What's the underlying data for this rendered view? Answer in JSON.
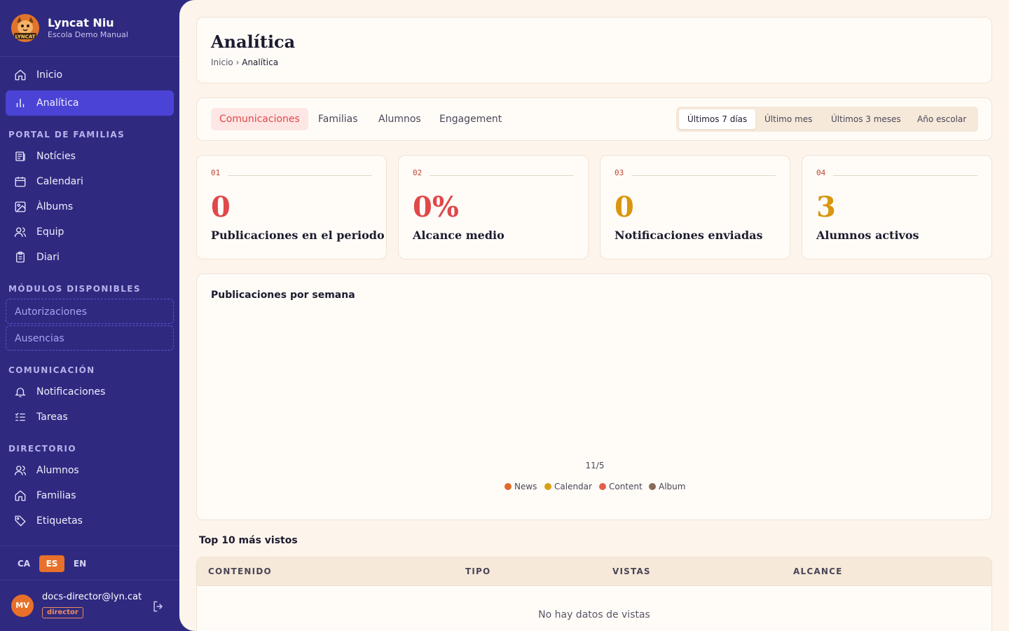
{
  "app": {
    "name": "Lyncat Niu",
    "school": "Escola Demo Manual",
    "logo_text": "LYNCAT"
  },
  "nav": {
    "main": [
      {
        "label": "Inicio",
        "icon": "home-icon"
      },
      {
        "label": "Analítica",
        "icon": "bar-chart-icon",
        "active": true
      }
    ],
    "sections": [
      {
        "title": "PORTAL DE FAMILIAS",
        "items": [
          {
            "label": "Notícies",
            "icon": "newspaper-icon"
          },
          {
            "label": "Calendari",
            "icon": "calendar-icon"
          },
          {
            "label": "Àlbums",
            "icon": "image-icon"
          },
          {
            "label": "Equip",
            "icon": "users-icon"
          },
          {
            "label": "Diari",
            "icon": "clipboard-icon"
          }
        ]
      },
      {
        "title": "MÓDULOS DISPONIBLES",
        "items": [
          {
            "label": "Autorizaciones"
          },
          {
            "label": "Ausencias"
          }
        ]
      },
      {
        "title": "COMUNICACIÓN",
        "items": [
          {
            "label": "Notificaciones",
            "icon": "bell-icon"
          },
          {
            "label": "Tareas",
            "icon": "list-icon"
          }
        ]
      },
      {
        "title": "DIRECTORIO",
        "items": [
          {
            "label": "Alumnos",
            "icon": "users-icon"
          },
          {
            "label": "Familias",
            "icon": "home-icon"
          },
          {
            "label": "Etiquetas",
            "icon": "tag-icon"
          }
        ]
      }
    ]
  },
  "languages": [
    {
      "code": "CA"
    },
    {
      "code": "ES",
      "active": true
    },
    {
      "code": "EN"
    }
  ],
  "user": {
    "initials": "MV",
    "email": "docs-director@lyn.cat",
    "role": "director"
  },
  "page": {
    "title": "Analítica",
    "breadcrumb": [
      "Inicio",
      "Analítica"
    ],
    "breadcrumb_sep": "›"
  },
  "tabs": [
    {
      "label": "Comunicaciones",
      "active": true
    },
    {
      "label": "Familias"
    },
    {
      "label": "Alumnos"
    },
    {
      "label": "Engagement"
    }
  ],
  "periods": [
    {
      "label": "Últimos 7 días",
      "active": true
    },
    {
      "label": "Último mes"
    },
    {
      "label": "Últimos 3 meses"
    },
    {
      "label": "Año escolar"
    }
  ],
  "kpis": [
    {
      "num": "01",
      "value": "0",
      "label": "Publicaciones en el periodo",
      "color": "#e0484a"
    },
    {
      "num": "02",
      "value": "0%",
      "label": "Alcance medio",
      "color": "#e0484a"
    },
    {
      "num": "03",
      "value": "0",
      "label": "Notificaciones enviadas",
      "color": "#d9960f"
    },
    {
      "num": "04",
      "value": "3",
      "label": "Alumnos activos",
      "color": "#d9960f"
    }
  ],
  "chart_data": {
    "type": "bar",
    "title": "Publicaciones por semana",
    "categories": [
      "11/5"
    ],
    "series": [
      {
        "name": "News",
        "values": [
          0
        ],
        "color": "#e06a2c"
      },
      {
        "name": "Calendar",
        "values": [
          0
        ],
        "color": "#d9a017"
      },
      {
        "name": "Content",
        "values": [
          0
        ],
        "color": "#e0604a"
      },
      {
        "name": "Album",
        "values": [
          0
        ],
        "color": "#8a6a5a"
      }
    ],
    "legend": "bottom",
    "grid": false
  },
  "top_views": {
    "title": "Top 10 más vistos",
    "columns": [
      "CONTENIDO",
      "TIPO",
      "VISTAS",
      "ALCANCE"
    ],
    "empty": "No hay datos de vistas"
  }
}
